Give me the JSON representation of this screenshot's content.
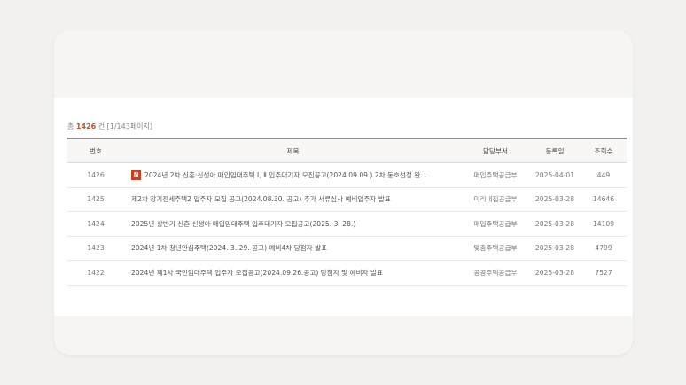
{
  "summary": {
    "prefix": "총",
    "total": "1426",
    "suffix": "건 [1/143페이지]"
  },
  "table": {
    "headers": [
      "번호",
      "제목",
      "담당부서",
      "등록일",
      "조회수"
    ],
    "rows": [
      {
        "no": "1426",
        "badge": "N",
        "title": "2024년 2차 신혼·신생아 매입임대주택 Ⅰ, Ⅱ 입주대기자 모집공고(2024.09.09.) 2차 동호선정 완…",
        "dept": "매입주택공급부",
        "date": "2025-04-01",
        "views": "449"
      },
      {
        "no": "1425",
        "title": "제2차 장기전세주택2 입주자 모집 공고(2024.08.30. 공고) 추가 서류심사 예비입주자 발표",
        "dept": "미리내집공급부",
        "date": "2025-03-28",
        "views": "14646"
      },
      {
        "no": "1424",
        "title": "2025년 상반기 신혼·신생아 매입임대주택 입주대기자 모집공고(2025. 3. 28.)",
        "dept": "매입주택공급부",
        "date": "2025-03-28",
        "views": "14109"
      },
      {
        "no": "1423",
        "title": "2024년 1차 청년안심주택(2024. 3. 29. 공고) 예비4차 당첨자 발표",
        "dept": "맞춤주택공급부",
        "date": "2025-03-28",
        "views": "4799"
      },
      {
        "no": "1422",
        "title": "2024년 제1차 국민임대주택 입주자 모집공고(2024.09.26.공고) 당첨자 및 예비자 발표",
        "dept": "공공주택공급부",
        "date": "2025-03-28",
        "views": "7527"
      }
    ]
  }
}
